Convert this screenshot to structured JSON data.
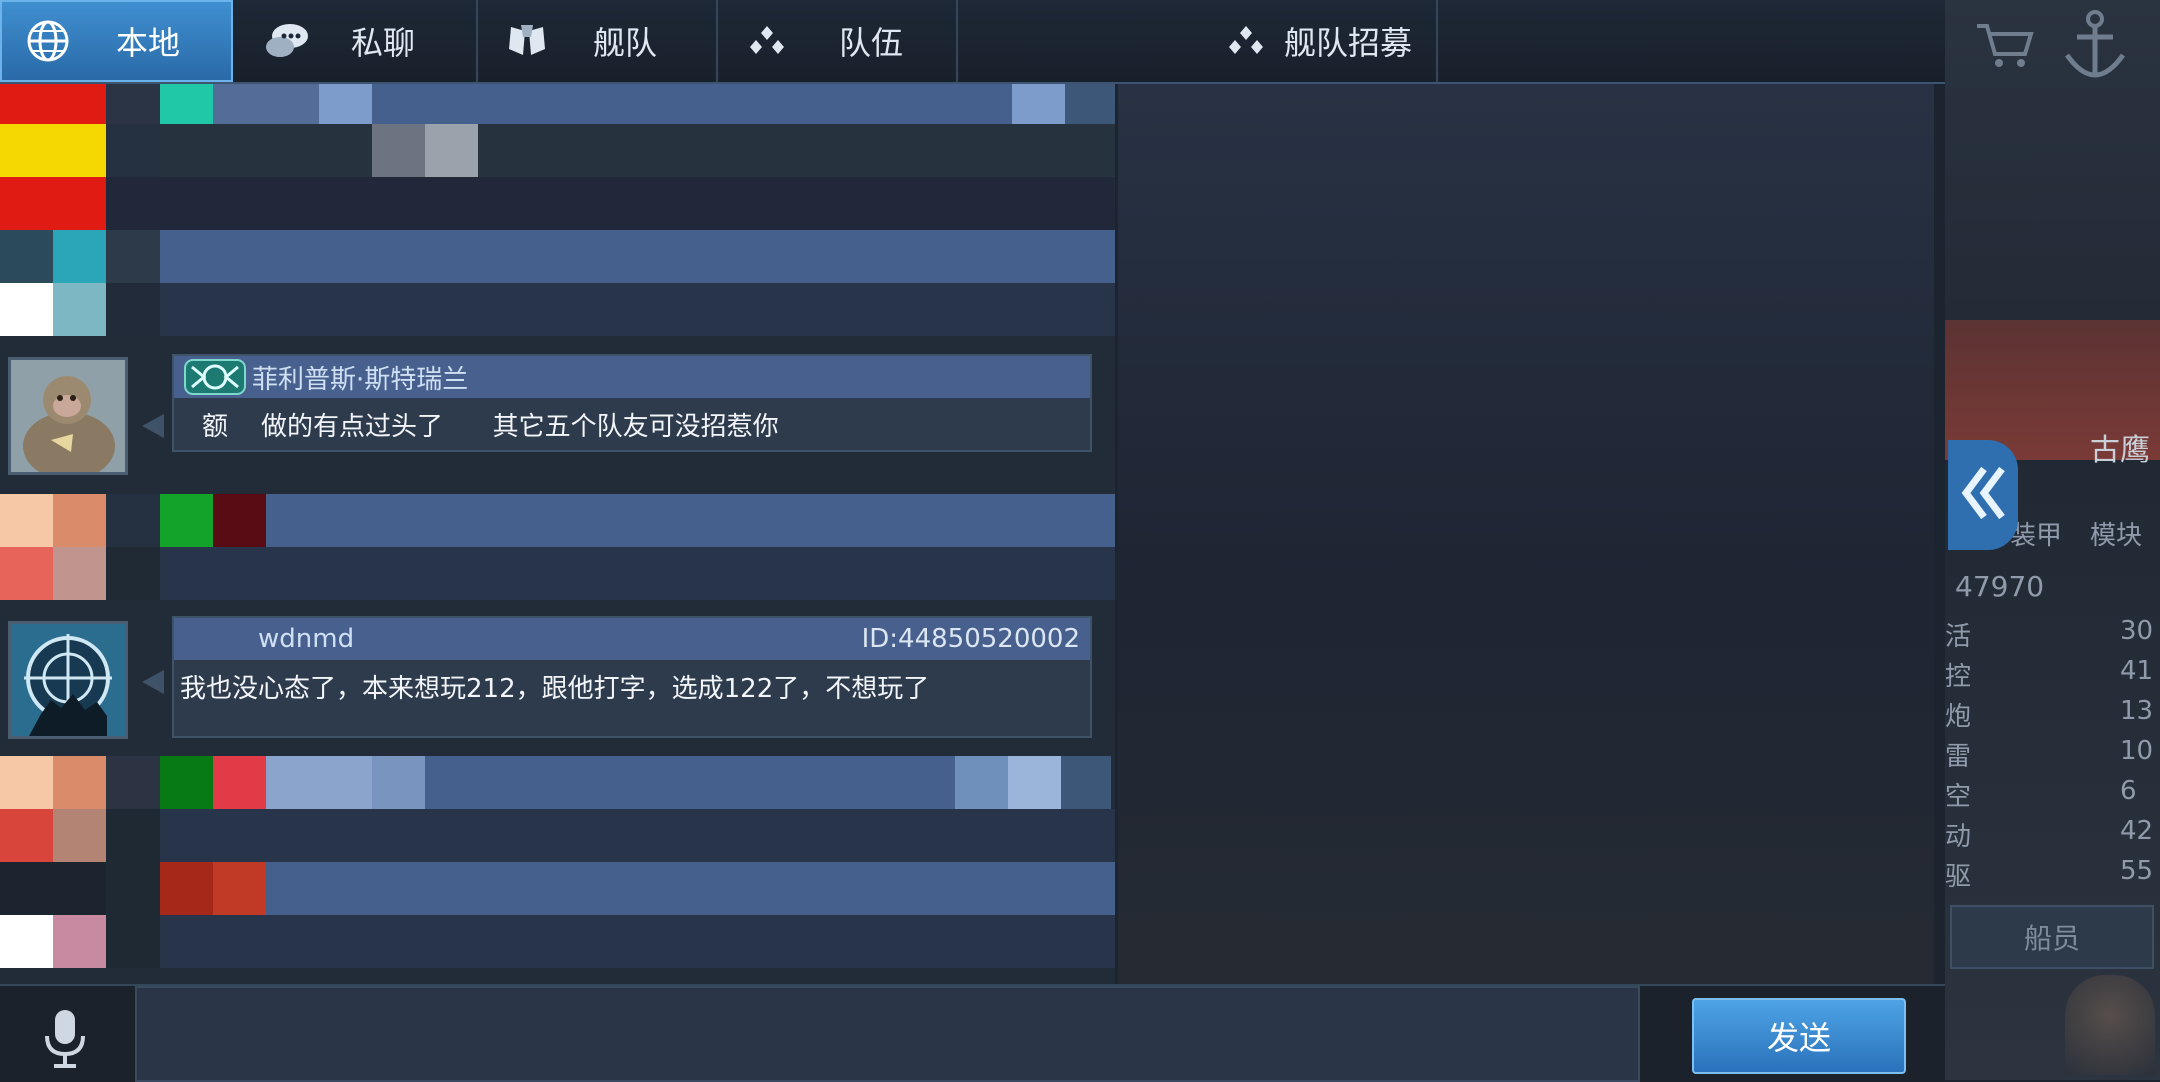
{
  "tabs": [
    {
      "label": "本地",
      "icon": "globe-icon",
      "active": true
    },
    {
      "label": "私聊",
      "icon": "chat-bubbles-icon",
      "active": false
    },
    {
      "label": "舰队",
      "icon": "fleet-shield-icon",
      "active": false
    },
    {
      "label": "队伍",
      "icon": "team-icon",
      "active": false
    },
    {
      "label": "舰队招募",
      "icon": "team-icon",
      "active": false
    }
  ],
  "messages": [
    {
      "name": "菲利普斯·斯特瑞兰",
      "id_text": "",
      "text": "额    做的有点过头了      其它五个队友可没招惹你",
      "avatar": "monkey-avatar"
    },
    {
      "name": "wdnmd",
      "id_text": "ID:44850520002",
      "text": "我也没心态了，本来想玩212，跟他打字，选成122了，不想玩了",
      "avatar": "radar-avatar"
    }
  ],
  "side_panel": {
    "ship_name": "古鹰",
    "labels": [
      "装甲",
      "模块"
    ],
    "score": "47970",
    "stats": [
      {
        "label": "活",
        "value": "30"
      },
      {
        "label": "控",
        "value": "41"
      },
      {
        "label": "炮",
        "value": "13"
      },
      {
        "label": "雷",
        "value": "10"
      },
      {
        "label": "空",
        "value": "6"
      },
      {
        "label": "动",
        "value": "42"
      },
      {
        "label": "驱",
        "value": "55"
      }
    ],
    "crew_button": "船员"
  },
  "input": {
    "placeholder": ""
  },
  "send_button": "发送",
  "colors": {
    "accent": "#2f7fc4",
    "header_bar": "#48608e",
    "bubble": "#2e3b4c"
  }
}
